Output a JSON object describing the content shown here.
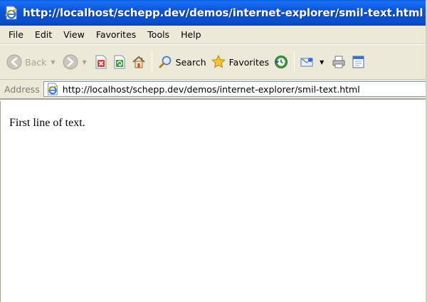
{
  "window": {
    "title": "http://localhost/schepp.dev/demos/internet-explorer/smil-text.html -",
    "icon": "ie-page-icon"
  },
  "menu": {
    "items": [
      "File",
      "Edit",
      "View",
      "Favorites",
      "Tools",
      "Help"
    ]
  },
  "toolbar": {
    "back_label": "Back",
    "search_label": "Search",
    "favorites_label": "Favorites"
  },
  "address": {
    "label": "Address",
    "url": "http://localhost/schepp.dev/demos/internet-explorer/smil-text.html"
  },
  "page": {
    "text": "First line of text."
  },
  "colors": {
    "titlebar": "#0a4fcd",
    "chrome": "#ece9d8",
    "content": "#ffffff"
  }
}
